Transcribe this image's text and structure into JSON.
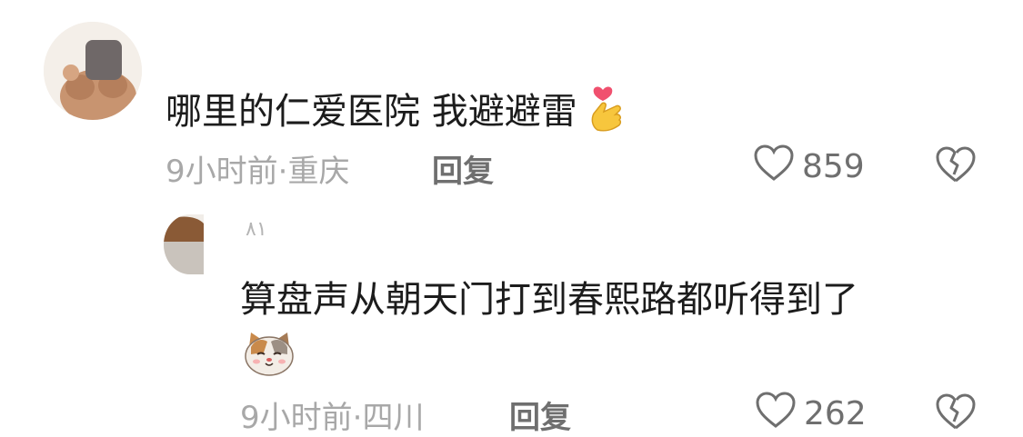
{
  "comments": [
    {
      "text": "哪里的仁爱医院 我避避雷",
      "emoji": "finger-heart-emoji",
      "time_location": "9小时前·重庆",
      "reply_label": "回复",
      "likes": "859"
    },
    {
      "username": "٨١",
      "text": "算盘声从朝天门打到春熙路都听得到了",
      "emoji": "cat-face-emoji",
      "time_location": "9小时前·四川",
      "reply_label": "回复",
      "likes": "262"
    }
  ]
}
